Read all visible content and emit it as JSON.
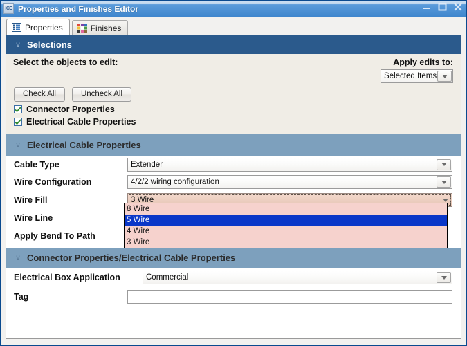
{
  "window": {
    "title": "Properties and Finishes Editor",
    "app_icon": "ICE",
    "icon_name": "ice-app-icon",
    "minimize_label": "Minimize",
    "maximize_label": "Maximize",
    "close_label": "Close"
  },
  "tabs": [
    {
      "label": "Properties",
      "icon": "list-icon",
      "active": true
    },
    {
      "label": "Finishes",
      "icon": "color-grid-icon",
      "active": false
    }
  ],
  "selections": {
    "header": "Selections",
    "chevron": "∨",
    "instruction": "Select the objects to edit:",
    "apply_label": "Apply edits to:",
    "apply_value": "Selected Items",
    "apply_options": [
      "Selected Items"
    ],
    "buttons": [
      {
        "label": "Check All"
      },
      {
        "label": "Uncheck All"
      }
    ],
    "checkboxes": [
      {
        "label": "Connector Properties",
        "checked": true
      },
      {
        "label": "Electrical Cable Properties",
        "checked": true
      }
    ]
  },
  "cable_section": {
    "header": "Electrical Cable Properties",
    "chevron": "∨",
    "rows": [
      {
        "label": "Cable Type",
        "value": "Extender",
        "type": "combo"
      },
      {
        "label": "Wire Configuration",
        "value": "4/2/2 wiring configuration",
        "type": "combo"
      },
      {
        "label": "Wire Fill",
        "value": "3 Wire",
        "type": "combo-open"
      },
      {
        "label": "Wire Line",
        "value": "",
        "type": "combo"
      },
      {
        "label": "Apply Bend To Path",
        "value": "",
        "type": "combo"
      }
    ],
    "wire_fill_options": [
      {
        "label": "8 Wire",
        "selected": false
      },
      {
        "label": "5 Wire",
        "selected": true
      },
      {
        "label": "4 Wire",
        "selected": false
      },
      {
        "label": "3 Wire",
        "selected": false
      }
    ]
  },
  "connector_section": {
    "header": "Connector Properties/Electrical Cable Properties",
    "chevron": "∨",
    "rows": [
      {
        "label": "Electrical Box Application",
        "value": "Commercial",
        "type": "combo"
      },
      {
        "label": "Tag",
        "value": "",
        "type": "text"
      }
    ]
  },
  "colors": {
    "titlebar": "#4a8bd0",
    "section_blue": "#2b5a8c",
    "section_steel": "#7da0bd",
    "cream": "#f0ede6",
    "dropdown_pink": "#f6d2cd",
    "dropdown_selected": "#0a37c8",
    "focus_peach": "#edcfc0"
  }
}
